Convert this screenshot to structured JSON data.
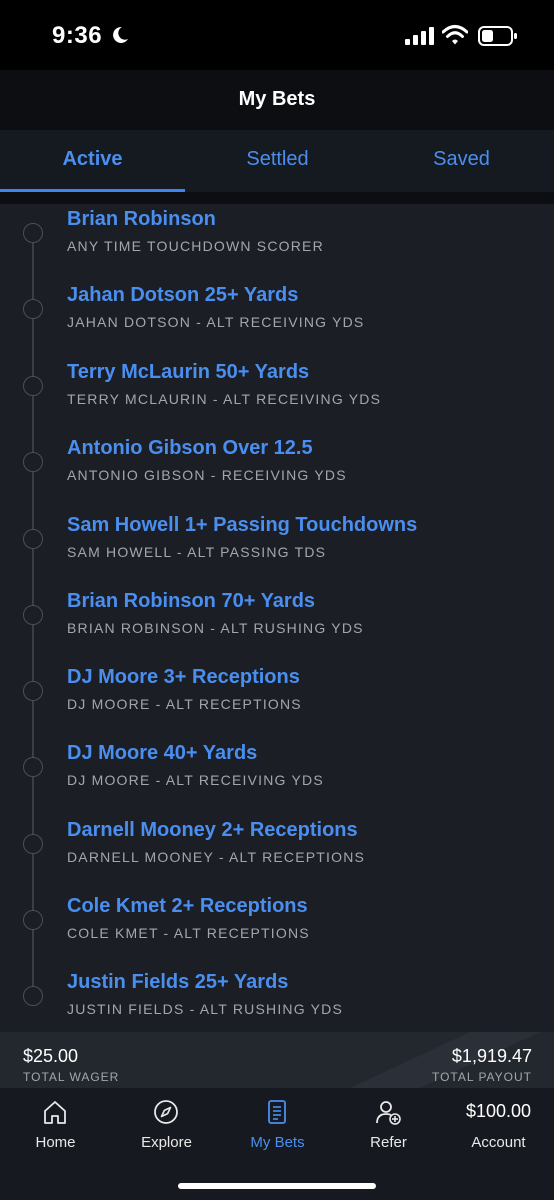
{
  "status_bar": {
    "time": "9:36"
  },
  "header": {
    "title": "My Bets"
  },
  "tabs": [
    {
      "label": "Active"
    },
    {
      "label": "Settled"
    },
    {
      "label": "Saved"
    }
  ],
  "active_tab": "Active",
  "bets": [
    {
      "title": "Brian Robinson",
      "subtitle": "ANY TIME TOUCHDOWN SCORER"
    },
    {
      "title": "Jahan Dotson 25+ Yards",
      "subtitle": "JAHAN DOTSON - ALT RECEIVING YDS"
    },
    {
      "title": "Terry McLaurin 50+ Yards",
      "subtitle": "TERRY MCLAURIN - ALT RECEIVING YDS"
    },
    {
      "title": "Antonio Gibson Over 12.5",
      "subtitle": "ANTONIO GIBSON - RECEIVING YDS"
    },
    {
      "title": "Sam Howell 1+ Passing Touchdowns",
      "subtitle": "SAM HOWELL - ALT PASSING TDS"
    },
    {
      "title": "Brian Robinson 70+ Yards",
      "subtitle": "BRIAN ROBINSON - ALT RUSHING YDS"
    },
    {
      "title": "DJ Moore 3+ Receptions",
      "subtitle": "DJ MOORE - ALT RECEPTIONS"
    },
    {
      "title": "DJ Moore 40+ Yards",
      "subtitle": "DJ MOORE - ALT RECEIVING YDS"
    },
    {
      "title": "Darnell Mooney 2+ Receptions",
      "subtitle": "DARNELL MOONEY - ALT RECEPTIONS"
    },
    {
      "title": "Cole Kmet 2+ Receptions",
      "subtitle": "COLE KMET - ALT RECEPTIONS"
    },
    {
      "title": "Justin Fields 25+ Yards",
      "subtitle": "JUSTIN FIELDS - ALT RUSHING YDS"
    }
  ],
  "totals": {
    "wager_amount": "$25.00",
    "wager_label": "TOTAL WAGER",
    "payout_amount": "$1,919.47",
    "payout_label": "TOTAL PAYOUT"
  },
  "nav": {
    "home": {
      "label": "Home",
      "icon": "home-icon"
    },
    "explore": {
      "label": "Explore",
      "icon": "compass-icon"
    },
    "my_bets": {
      "label": "My Bets",
      "icon": "bet-slip-icon"
    },
    "refer": {
      "label": "Refer",
      "icon": "add-user-icon"
    },
    "account": {
      "label": "Account",
      "balance": "$100.00"
    }
  },
  "colors": {
    "accent": "#4a8ff0",
    "background": "#1b1e25",
    "muted_text": "#a3a7ad"
  }
}
